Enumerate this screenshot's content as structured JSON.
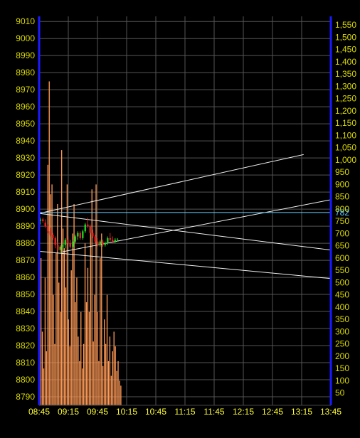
{
  "chart_data": {
    "type": "candlestick",
    "title": "",
    "colors": {
      "background": "#000000",
      "axis_border": "#1a1aff",
      "axis_label": "#d8d800",
      "xaxis_label": "#ffff33",
      "grid": "#555555",
      "trendline": "#f0f0f0",
      "price_line": "#66ccff",
      "volume": "#ff9955",
      "candle_up": "#22cc22",
      "candle_down": "#dd2222",
      "last_price_label": "#66ccff"
    },
    "x_ticks": [
      "08:45",
      "09:15",
      "09:45",
      "10:15",
      "10:45",
      "11:15",
      "11:45",
      "12:15",
      "12:45",
      "13:15",
      "13:45"
    ],
    "x_range": [
      "08:45",
      "13:45"
    ],
    "price_axis": {
      "ticks": [
        9010,
        9000,
        8990,
        8980,
        8970,
        8960,
        8950,
        8940,
        8930,
        8920,
        8910,
        8900,
        8890,
        8880,
        8870,
        8860,
        8850,
        8840,
        8830,
        8820,
        8810,
        8800,
        8790
      ],
      "range": [
        8785,
        9013
      ]
    },
    "volume_axis": {
      "ticks": [
        "1,550",
        "1,500",
        "1,450",
        "1,400",
        "1,350",
        "1,300",
        "1,250",
        "1,200",
        "1,150",
        "1,100",
        "1,050",
        "1,000",
        "950",
        "900",
        "850",
        "800",
        "750",
        "700",
        "650",
        "600",
        "550",
        "500",
        "450",
        "400",
        "350",
        "300",
        "250",
        "200",
        "150",
        "100",
        "50"
      ],
      "range": [
        0,
        1585
      ]
    },
    "last_price_label": "782",
    "last_price": 8898,
    "trendlines": [
      {
        "x1": "08:45",
        "y1": 8897.5,
        "x2": "13:45",
        "y2": 8876.0
      },
      {
        "x1": "08:45",
        "y1": 8897.5,
        "x2": "13:17",
        "y2": 8932.0
      },
      {
        "x1": "09:09",
        "y1": 8875.0,
        "x2": "13:45",
        "y2": 8905.5
      },
      {
        "x1": "08:45",
        "y1": 8875.3,
        "x2": "13:45",
        "y2": 8859.3
      }
    ],
    "candles": [
      {
        "o": 8893,
        "h": 8895,
        "l": 8891,
        "c": 8894
      },
      {
        "o": 8894,
        "h": 8895,
        "l": 8892,
        "c": 8893
      },
      {
        "o": 8892,
        "h": 8894,
        "l": 8889,
        "c": 8890
      },
      {
        "o": 8890,
        "h": 8891,
        "l": 8886,
        "c": 8887
      },
      {
        "o": 8887,
        "h": 8889,
        "l": 8884,
        "c": 8885
      },
      {
        "o": 8885,
        "h": 8886,
        "l": 8882,
        "c": 8883
      },
      {
        "o": 8883,
        "h": 8884,
        "l": 8877,
        "c": 8879
      },
      {
        "o": 8879,
        "h": 8881,
        "l": 8875,
        "c": 8876
      },
      {
        "o": 8876,
        "h": 8879,
        "l": 8874,
        "c": 8878
      },
      {
        "o": 8878,
        "h": 8880,
        "l": 8876,
        "c": 8879
      },
      {
        "o": 8879,
        "h": 8883,
        "l": 8877,
        "c": 8882
      },
      {
        "o": 8882,
        "h": 8884,
        "l": 8879,
        "c": 8880
      },
      {
        "o": 8880,
        "h": 8882,
        "l": 8877,
        "c": 8878
      },
      {
        "o": 8878,
        "h": 8882,
        "l": 8877,
        "c": 8881
      },
      {
        "o": 8881,
        "h": 8885,
        "l": 8880,
        "c": 8884
      },
      {
        "o": 8884,
        "h": 8887,
        "l": 8882,
        "c": 8886
      },
      {
        "o": 8886,
        "h": 8887,
        "l": 8882,
        "c": 8883
      },
      {
        "o": 8883,
        "h": 8888,
        "l": 8882,
        "c": 8887
      },
      {
        "o": 8887,
        "h": 8892,
        "l": 8886,
        "c": 8891
      },
      {
        "o": 8891,
        "h": 8895,
        "l": 8889,
        "c": 8890
      },
      {
        "o": 8890,
        "h": 8891,
        "l": 8885,
        "c": 8886
      },
      {
        "o": 8886,
        "h": 8888,
        "l": 8883,
        "c": 8884
      },
      {
        "o": 8884,
        "h": 8885,
        "l": 8880,
        "c": 8881
      },
      {
        "o": 8881,
        "h": 8883,
        "l": 8878,
        "c": 8879
      },
      {
        "o": 8879,
        "h": 8882,
        "l": 8878,
        "c": 8881
      },
      {
        "o": 8881,
        "h": 8882,
        "l": 8878,
        "c": 8879
      },
      {
        "o": 8879,
        "h": 8881,
        "l": 8878,
        "c": 8880
      },
      {
        "o": 8880,
        "h": 8884,
        "l": 8879,
        "c": 8883
      },
      {
        "o": 8883,
        "h": 8886,
        "l": 8881,
        "c": 8882
      },
      {
        "o": 8882,
        "h": 8884,
        "l": 8880,
        "c": 8881
      },
      {
        "o": 8881,
        "h": 8883,
        "l": 8880,
        "c": 8882
      },
      {
        "o": 8882,
        "h": 8883,
        "l": 8881,
        "c": 8882
      }
    ],
    "volumes": [
      250,
      600,
      300,
      150,
      520,
      220,
      980,
      1320,
      860,
      900,
      450,
      250,
      620,
      820,
      500,
      380,
      1040,
      720,
      640,
      480,
      900,
      350,
      240,
      550,
      700,
      820,
      420,
      520,
      280,
      180,
      380,
      150,
      250,
      660,
      420,
      560,
      380,
      720,
      880,
      260,
      450,
      900,
      380,
      180,
      600,
      700,
      160,
      350,
      250,
      450,
      180,
      280,
      120,
      220,
      300,
      240,
      140,
      180,
      100,
      80
    ]
  }
}
